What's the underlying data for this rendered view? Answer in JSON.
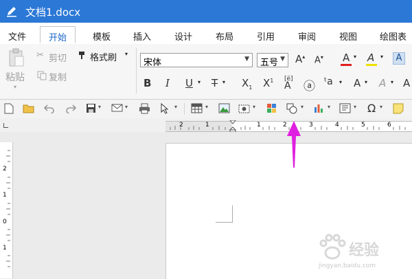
{
  "titlebar": {
    "title": "文档1.docx"
  },
  "tabs": [
    "文件",
    "开始",
    "模板",
    "插入",
    "设计",
    "布局",
    "引用",
    "审阅",
    "视图",
    "绘图表"
  ],
  "active_tab_index": 1,
  "clipboard": {
    "paste": "粘贴",
    "cut": "剪切",
    "copy": "复制",
    "format_painter": "格式刷"
  },
  "font": {
    "name": "宋体",
    "size": "五号"
  },
  "vertical_ruler_labels": [
    "2",
    "1",
    "0",
    "1"
  ],
  "horizontal_ruler_labels": [
    "2",
    "1",
    "1",
    "2",
    "3",
    "4",
    "5",
    "6"
  ],
  "watermark": {
    "brand": "经验",
    "url": "jingyan.baidu.com"
  },
  "colors": {
    "title_bar": "#2b78d6",
    "active_tab_text": "#1a66c8",
    "arrow": "#e020e0",
    "font_color_bar": "#e02020",
    "highlight_bar": "#f0e000"
  }
}
